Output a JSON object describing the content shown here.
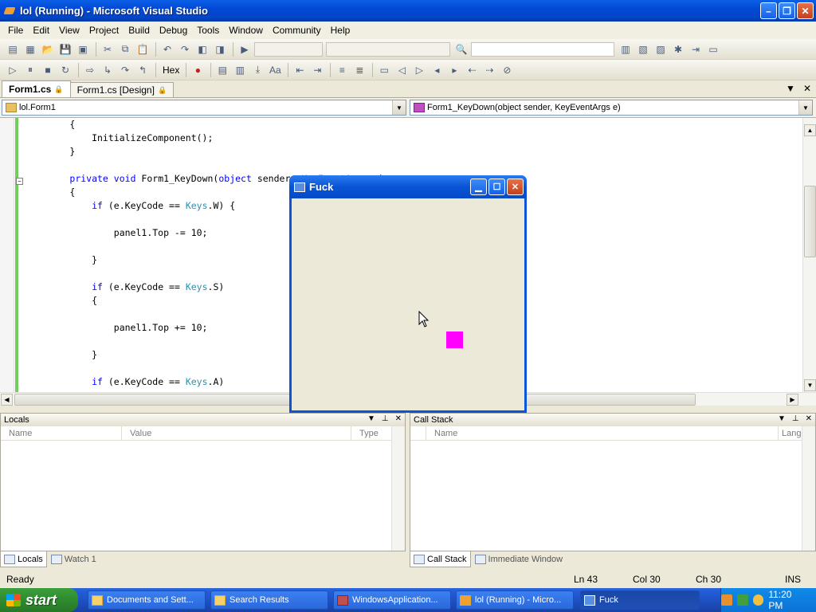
{
  "window": {
    "title": "lol (Running) - Microsoft Visual Studio",
    "minimize_label": "–",
    "maximize_label": "❐",
    "close_label": "✕"
  },
  "menu": [
    "File",
    "Edit",
    "View",
    "Project",
    "Build",
    "Debug",
    "Tools",
    "Window",
    "Community",
    "Help"
  ],
  "toolbar": {
    "hex_label": "Hex"
  },
  "doc_tabs": [
    {
      "label": "Form1.cs",
      "active": true
    },
    {
      "label": "Form1.cs [Design]",
      "active": false
    }
  ],
  "nav": {
    "class_combo": "lol.Form1",
    "member_combo": "Form1_KeyDown(object sender, KeyEventArgs e)"
  },
  "code_lines": [
    "        {",
    "            InitializeComponent();",
    "        }",
    "",
    "        private void Form1_KeyDown(object sender, KeyEventArgs e)",
    "        {",
    "            if (e.KeyCode == Keys.W) {",
    "",
    "                panel1.Top -= 10;",
    "",
    "            }",
    "",
    "            if (e.KeyCode == Keys.S)",
    "            {",
    "",
    "                panel1.Top += 10;",
    "",
    "            }",
    "",
    "            if (e.KeyCode == Keys.A)"
  ],
  "form": {
    "title": "Fuck",
    "accent": "#FF00FF"
  },
  "locals": {
    "title": "Locals",
    "columns": [
      "Name",
      "Value",
      "Type"
    ]
  },
  "callstack": {
    "title": "Call Stack",
    "columns": [
      "Name",
      "Lang"
    ]
  },
  "left_tabs": [
    {
      "label": "Locals",
      "active": true
    },
    {
      "label": "Watch 1",
      "active": false
    }
  ],
  "right_tabs": [
    {
      "label": "Call Stack",
      "active": true
    },
    {
      "label": "Immediate Window",
      "active": false
    }
  ],
  "status": {
    "text": "Ready",
    "ln": "Ln 43",
    "col": "Col 30",
    "ch": "Ch 30",
    "mode": "INS"
  },
  "taskbar": {
    "start_label": "start",
    "tasks": [
      {
        "label": "Documents and Sett..."
      },
      {
        "label": "Search Results"
      },
      {
        "label": "WindowsApplication..."
      },
      {
        "label": "lol (Running) - Micro..."
      },
      {
        "label": "Fuck",
        "active": true
      }
    ],
    "clock": "11:20 PM"
  }
}
